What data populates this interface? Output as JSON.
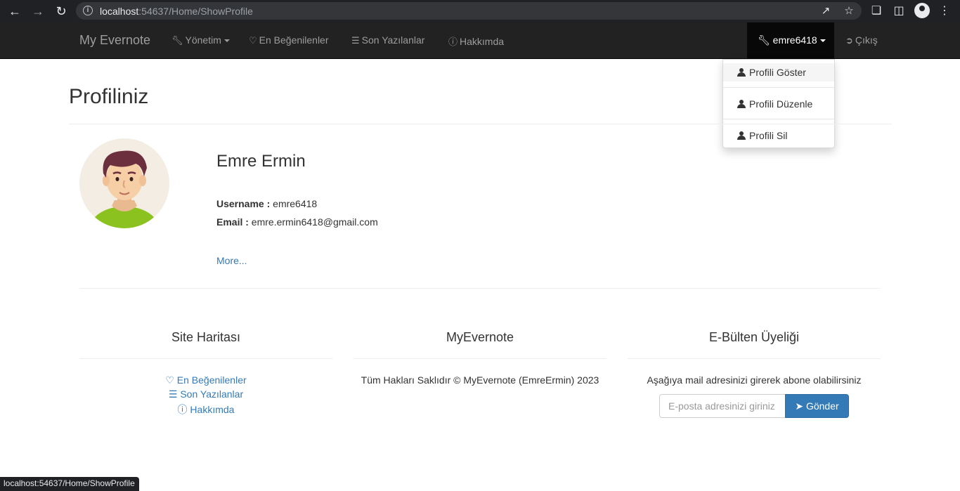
{
  "browser": {
    "url_host": "localhost",
    "url_rest": ":54637/Home/ShowProfile",
    "status_url": "localhost:54637/Home/ShowProfile"
  },
  "navbar": {
    "brand": "My Evernote",
    "items": [
      {
        "label": "Yönetim",
        "icon": "wrench-icon"
      },
      {
        "label": "En Beğenilenler",
        "icon": "heart-icon"
      },
      {
        "label": "Son Yazılanlar",
        "icon": "list-icon"
      },
      {
        "label": "Hakkımda",
        "icon": "info-icon"
      }
    ],
    "user": "emre6418",
    "logout": "Çıkış"
  },
  "user_menu": {
    "items": [
      "Profili Göster",
      "Profili Düzenle",
      "Profili Sil"
    ]
  },
  "page": {
    "title": "Profiliniz"
  },
  "profile": {
    "name": "Emre Ermin",
    "username_label": "Username :",
    "username": "emre6418",
    "email_label": "Email :",
    "email": "emre.ermin6418@gmail.com",
    "more": "More..."
  },
  "footer": {
    "sitemap": {
      "title": "Site Haritası",
      "links": [
        "En Beğenilenler",
        "Son Yazılanlar",
        "Hakkımda"
      ]
    },
    "about": {
      "title": "MyEvernote",
      "text": "Tüm Hakları Saklıdır © MyEvernote (EmreErmin) 2023"
    },
    "newsletter": {
      "title": "E-Bülten Üyeliği",
      "text": "Aşağıya mail adresinizi girerek abone olabilirsiniz",
      "placeholder": "E-posta adresinizi giriniz",
      "button": "Gönder"
    }
  },
  "colors": {
    "navbar_bg": "#222222",
    "link": "#337ab7",
    "button": "#337ab7"
  }
}
